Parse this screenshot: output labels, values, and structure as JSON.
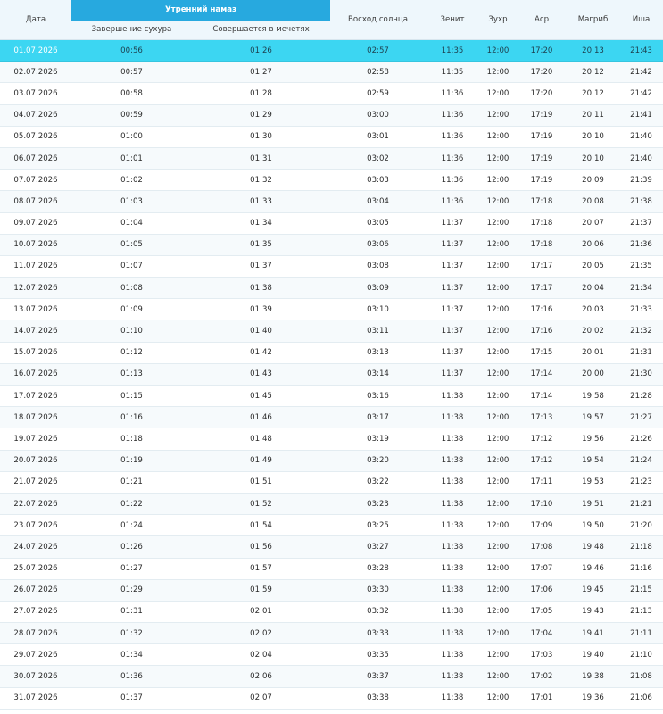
{
  "headers": {
    "date": "Дата",
    "morning_prayer": "Утренний намаз",
    "sahur_end": "Завершение сухура",
    "mosque_time": "Совершается в мечетях",
    "sunrise": "Восход солнца",
    "zenith": "Зенит",
    "zuhr": "Зухр",
    "asr": "Аср",
    "maghrib": "Магриб",
    "isha": "Иша"
  },
  "highlight_color": "#3cd6f2",
  "header_accent_color": "#27a9df",
  "current_row_index": 0,
  "rows": [
    [
      "01.07.2026",
      "00:56",
      "01:26",
      "02:57",
      "11:35",
      "12:00",
      "17:20",
      "20:13",
      "21:43"
    ],
    [
      "02.07.2026",
      "00:57",
      "01:27",
      "02:58",
      "11:35",
      "12:00",
      "17:20",
      "20:12",
      "21:42"
    ],
    [
      "03.07.2026",
      "00:58",
      "01:28",
      "02:59",
      "11:36",
      "12:00",
      "17:20",
      "20:12",
      "21:42"
    ],
    [
      "04.07.2026",
      "00:59",
      "01:29",
      "03:00",
      "11:36",
      "12:00",
      "17:19",
      "20:11",
      "21:41"
    ],
    [
      "05.07.2026",
      "01:00",
      "01:30",
      "03:01",
      "11:36",
      "12:00",
      "17:19",
      "20:10",
      "21:40"
    ],
    [
      "06.07.2026",
      "01:01",
      "01:31",
      "03:02",
      "11:36",
      "12:00",
      "17:19",
      "20:10",
      "21:40"
    ],
    [
      "07.07.2026",
      "01:02",
      "01:32",
      "03:03",
      "11:36",
      "12:00",
      "17:19",
      "20:09",
      "21:39"
    ],
    [
      "08.07.2026",
      "01:03",
      "01:33",
      "03:04",
      "11:36",
      "12:00",
      "17:18",
      "20:08",
      "21:38"
    ],
    [
      "09.07.2026",
      "01:04",
      "01:34",
      "03:05",
      "11:37",
      "12:00",
      "17:18",
      "20:07",
      "21:37"
    ],
    [
      "10.07.2026",
      "01:05",
      "01:35",
      "03:06",
      "11:37",
      "12:00",
      "17:18",
      "20:06",
      "21:36"
    ],
    [
      "11.07.2026",
      "01:07",
      "01:37",
      "03:08",
      "11:37",
      "12:00",
      "17:17",
      "20:05",
      "21:35"
    ],
    [
      "12.07.2026",
      "01:08",
      "01:38",
      "03:09",
      "11:37",
      "12:00",
      "17:17",
      "20:04",
      "21:34"
    ],
    [
      "13.07.2026",
      "01:09",
      "01:39",
      "03:10",
      "11:37",
      "12:00",
      "17:16",
      "20:03",
      "21:33"
    ],
    [
      "14.07.2026",
      "01:10",
      "01:40",
      "03:11",
      "11:37",
      "12:00",
      "17:16",
      "20:02",
      "21:32"
    ],
    [
      "15.07.2026",
      "01:12",
      "01:42",
      "03:13",
      "11:37",
      "12:00",
      "17:15",
      "20:01",
      "21:31"
    ],
    [
      "16.07.2026",
      "01:13",
      "01:43",
      "03:14",
      "11:37",
      "12:00",
      "17:14",
      "20:00",
      "21:30"
    ],
    [
      "17.07.2026",
      "01:15",
      "01:45",
      "03:16",
      "11:38",
      "12:00",
      "17:14",
      "19:58",
      "21:28"
    ],
    [
      "18.07.2026",
      "01:16",
      "01:46",
      "03:17",
      "11:38",
      "12:00",
      "17:13",
      "19:57",
      "21:27"
    ],
    [
      "19.07.2026",
      "01:18",
      "01:48",
      "03:19",
      "11:38",
      "12:00",
      "17:12",
      "19:56",
      "21:26"
    ],
    [
      "20.07.2026",
      "01:19",
      "01:49",
      "03:20",
      "11:38",
      "12:00",
      "17:12",
      "19:54",
      "21:24"
    ],
    [
      "21.07.2026",
      "01:21",
      "01:51",
      "03:22",
      "11:38",
      "12:00",
      "17:11",
      "19:53",
      "21:23"
    ],
    [
      "22.07.2026",
      "01:22",
      "01:52",
      "03:23",
      "11:38",
      "12:00",
      "17:10",
      "19:51",
      "21:21"
    ],
    [
      "23.07.2026",
      "01:24",
      "01:54",
      "03:25",
      "11:38",
      "12:00",
      "17:09",
      "19:50",
      "21:20"
    ],
    [
      "24.07.2026",
      "01:26",
      "01:56",
      "03:27",
      "11:38",
      "12:00",
      "17:08",
      "19:48",
      "21:18"
    ],
    [
      "25.07.2026",
      "01:27",
      "01:57",
      "03:28",
      "11:38",
      "12:00",
      "17:07",
      "19:46",
      "21:16"
    ],
    [
      "26.07.2026",
      "01:29",
      "01:59",
      "03:30",
      "11:38",
      "12:00",
      "17:06",
      "19:45",
      "21:15"
    ],
    [
      "27.07.2026",
      "01:31",
      "02:01",
      "03:32",
      "11:38",
      "12:00",
      "17:05",
      "19:43",
      "21:13"
    ],
    [
      "28.07.2026",
      "01:32",
      "02:02",
      "03:33",
      "11:38",
      "12:00",
      "17:04",
      "19:41",
      "21:11"
    ],
    [
      "29.07.2026",
      "01:34",
      "02:04",
      "03:35",
      "11:38",
      "12:00",
      "17:03",
      "19:40",
      "21:10"
    ],
    [
      "30.07.2026",
      "01:36",
      "02:06",
      "03:37",
      "11:38",
      "12:00",
      "17:02",
      "19:38",
      "21:08"
    ],
    [
      "31.07.2026",
      "01:37",
      "02:07",
      "03:38",
      "11:38",
      "12:00",
      "17:01",
      "19:36",
      "21:06"
    ]
  ]
}
